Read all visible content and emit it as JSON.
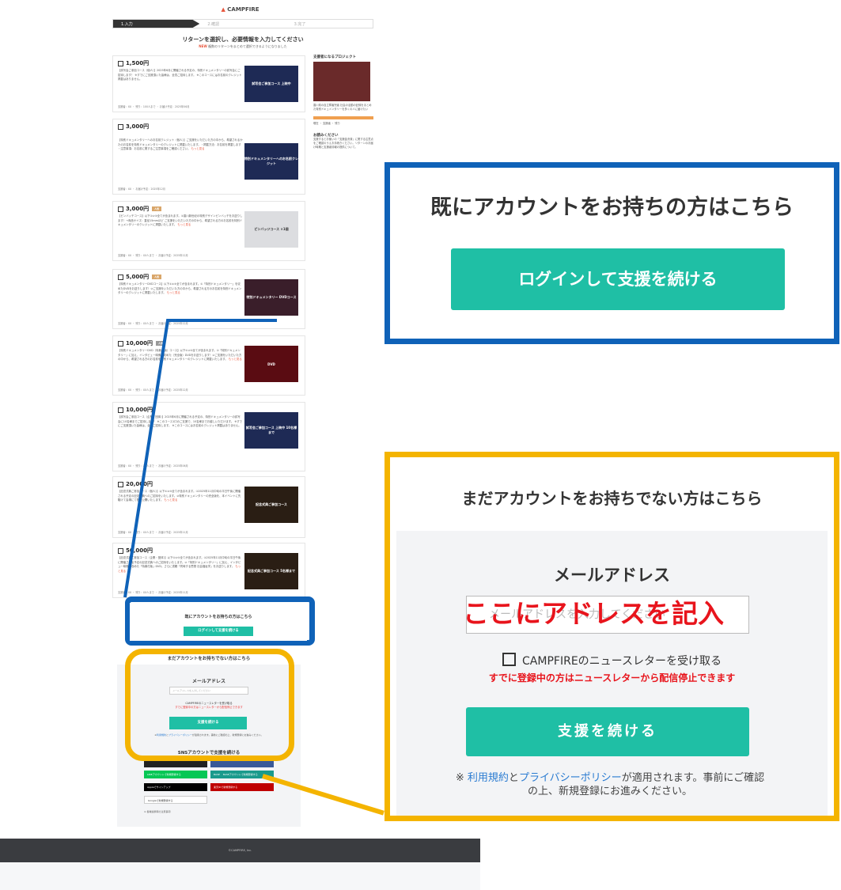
{
  "header": {
    "logo": "CAMPFIRE",
    "steps": [
      "1.入力",
      "2.確認",
      "3.完了"
    ]
  },
  "page": {
    "title": "リターンを選択し、必要情報を入力してください",
    "note_tag": "NEW",
    "note": "複数のリターンをまとめて選択できるようになりました"
  },
  "rewards": [
    {
      "price": "1,500円",
      "desc": "【試写会ご参加コース（個人）】2025年6月に開催される予定の、特別ドキュメンタリーの試写会にご招待します！ ※すでにご支援頂いた皆様は、全員ご招待します。 ※このコースにはお名前のクレジット掲載はありません。",
      "more": "",
      "thumb": "試写会ご参加コース 上映中",
      "meta": "支援者：XX ・ 残り：100人まで ・ お届け予定：2025年06月"
    },
    {
      "price": "3,000円",
      "desc": "【特別ドキュメンタリーへのお名前クレジット（個人）】ご支援をいただいた方の中から、希望されるかたのお名前を特別ドキュメンタリーのクレジットに掲載いたします。・掲載方法：お名前を掲載します ・注意事項：お名前に関するご注意事項をご確認ください。",
      "more": "もっと見る",
      "thumb": "特別ドキュメンタリーへのお名前クレジット",
      "meta": "支援者：XX ・ お届け予定：2025年12月"
    },
    {
      "price": "3,000円",
      "badge": "人気",
      "desc": "【ピンバッチコース】以下①②③全てが含まれます。①香川新世紀の特別デザインピンバッチをお送りします！→商品サイズ：直径15mmほど ご支援をいただいた方の中から、希望される方のお名前を特別ドキュメンタリーのクレジットに掲載いたします。",
      "more": "もっと見る",
      "thumb": "ピンバッジコース ×1個",
      "meta": "支援者：XX ・ 残り：XX人まで ・ お届け予定：2025年12月"
    },
    {
      "price": "5,000円",
      "badge": "人気",
      "desc": "【特別ドキュメンタリーDVDコース】以下①②③全てが含まれます。①「特別ドキュメンタリー」を収めたDVDをお送りします！②ご支援をいただいた方の中から、希望される方のお名前を特別ドキュメンタリーのクレジットに掲載いたします。",
      "more": "もっと見る",
      "thumb": "特別ドキュメンタリー DVDコース",
      "meta": "支援者：XX ・ 残り：XX人まで ・ お届け予定：2025年12月"
    },
    {
      "price": "10,000円",
      "badge": "人気",
      "desc": "【特別ドキュメンタリーDVD（特典付版）コース】以下①②③全てが含まれます。①「特別ドキュメンタリー」に加え、インタビュー映像も収めた（完全版）DVDをお送りします！②ご支援をいただいた方の中から、希望される方のお名前を特別ドキュメンタリーのクレジットに掲載いたします。",
      "more": "もっと見る",
      "thumb": "DVD",
      "meta": "支援者：XX ・ 残り：XX人まで ・ お届け予定：2025年12月"
    },
    {
      "price": "10,000円",
      "desc": "【試写会ご参加コース（企業・団体）】2025年6月に開催される予定の、特別ドキュメンタリーの試写会に10名様までご招待します！ ※このコース1口のご支援で、10名様までお越しいただけます。 ※すでにご支援頂いた皆様は、全員ご招待します。 ※このコースにはお名前のクレジット掲載はありません。",
      "more": "",
      "thumb": "試写会ご参加コース 上映中 10名様まで",
      "meta": "支援者：XX ・ 残り：XX人まで ・ お届け予定：2025年06月"
    },
    {
      "price": "20,000円",
      "desc": "【記念式典ご参加コース（個人）】以下①②③全てが含まれます。①2025年11月中旬の平日午後に開催される予定の記念式典へのご招待をいたします。②特別ドキュメンタリーの完全版を、本イベントに先駆けて会場にて限定公開いたします。",
      "more": "もっと見る",
      "thumb": "記念式典ご参加コース",
      "meta": "支援者：XX ・ 残り：XX人まで ・ お届け予定：2025年11月"
    },
    {
      "price": "50,000円",
      "desc": "【記念式典ご参加コース（企業・団体）】以下①②③全てが含まれます。①2025年11月中旬の平日午後に開催される予定の記念式典へのご招待をいたします。②「特別ドキュメンタリー」に加え、インタビュー映像も収めた「特典付版」DVD。さらに書籍「同時する思想 社会福祉学」をお送りします。",
      "more": "もっと見る",
      "thumb": "記念式典ご参加コース 5名様まで",
      "meta": "支援者：XX ・ 残り：XX人まで ・ お届け予定：2025年11月"
    }
  ],
  "sidebar": {
    "project_head": "支援者になるプロジェクト",
    "project_desc": "香川県の自立障害児者 社会の活動の記録をまとめた特別ドキュメンタリーを多くの人に届けたい",
    "stats": "現在 ・ 支援者 ・ 残り",
    "notes_head": "お読みください",
    "notes": "支援するとお使いの「支援金決済」に関する注意点をご確認のうえお手続きください。リターンのお届け時期と支援者情報の提供について。"
  },
  "login": {
    "title": "既にアカウントをお持ちの方はこちら",
    "button": "ログインして支援を続ける"
  },
  "register": {
    "title": "まだアカウントをお持ちでない方はこちら",
    "email_label": "メールアドレス",
    "email_placeholder": "メールアドレスを入力してください",
    "newsletter": "CAMPFIREのニュースレターを受け取る",
    "newsletter_note": "すでに登録中の方はニュースレターから配信停止できます",
    "continue": "支援を続ける",
    "terms_prefix": "※",
    "terms_link": "利用規約",
    "terms_and": "と",
    "privacy_link": "プライバシーポリシー",
    "terms_suffix": "が適用されます。事前にご確認の上、新規登録にお進みください。",
    "sns_title": "SNSアカウントで支援を続ける",
    "sns": [
      "LINEアカウントで新規登録する",
      "BASE 　BASEアカウントで新規登録する",
      "Appleでサインアップ",
      "楽天IDで新規登録する",
      "Googleで新規登録する"
    ],
    "sns_note": "※ 各種連携時の注意事項"
  },
  "annotation": {
    "email_hint": "ここにアドレスを記入"
  },
  "footer": {
    "copyright": "©CAMPFIRE, Inc."
  },
  "colors": {
    "accent": "#1fbfa5",
    "brand": "#e8553c",
    "zoom_blue": "#0f62b8",
    "zoom_yellow": "#f4b400",
    "annotation_red": "#e8141c"
  }
}
